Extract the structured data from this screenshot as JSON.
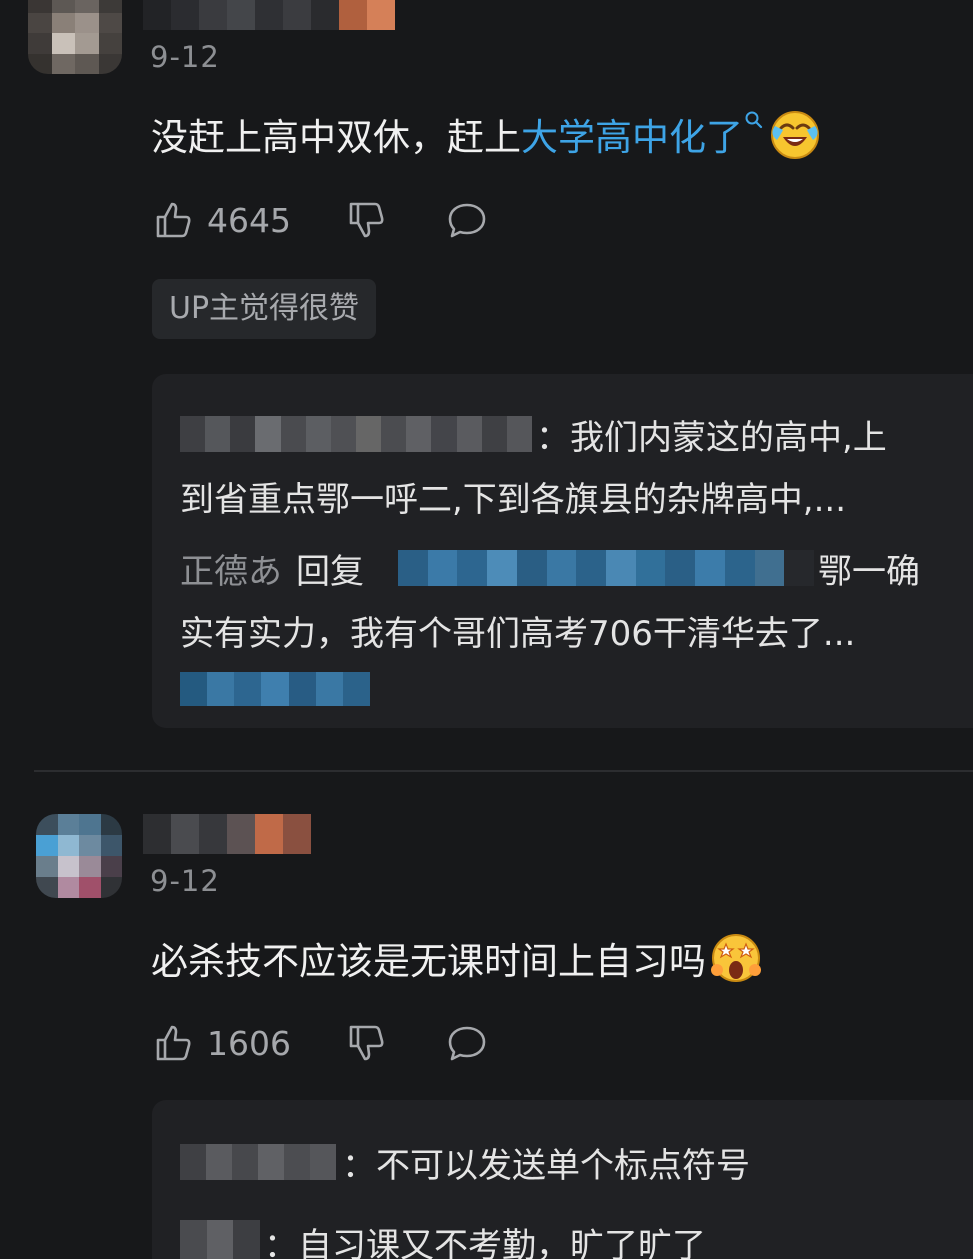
{
  "comments": [
    {
      "date": "9-12",
      "text_prefix": "没赶上高中双休，赶上",
      "topic_link": "大学高中化了",
      "emoji_icon": "tears-of-joy-emoji",
      "likes": "4645",
      "up_badge": "UP主觉得很赞",
      "replies": {
        "line1": "：我们内蒙这的高中,上",
        "line2": "到省重点鄂一呼二,下到各旗县的杂牌高中,...",
        "reply_author": "正德あ",
        "reply_word": "回复",
        "line3_tail": "鄂一确",
        "line4": "实有实力，我有个哥们高考706干清华去了..."
      }
    },
    {
      "date": "9-12",
      "text": "必杀技不应该是无课时间上自习吗",
      "emoji_icon": "starstruck-scream-emoji",
      "likes": "1606",
      "replies": {
        "line1": "：不可以发送单个标点符号",
        "line2": "：自习课又不考勤，旷了旷了"
      }
    }
  ],
  "colors": {
    "background": "#17181a",
    "link": "#3ea4e6",
    "muted": "#8d8f93"
  }
}
